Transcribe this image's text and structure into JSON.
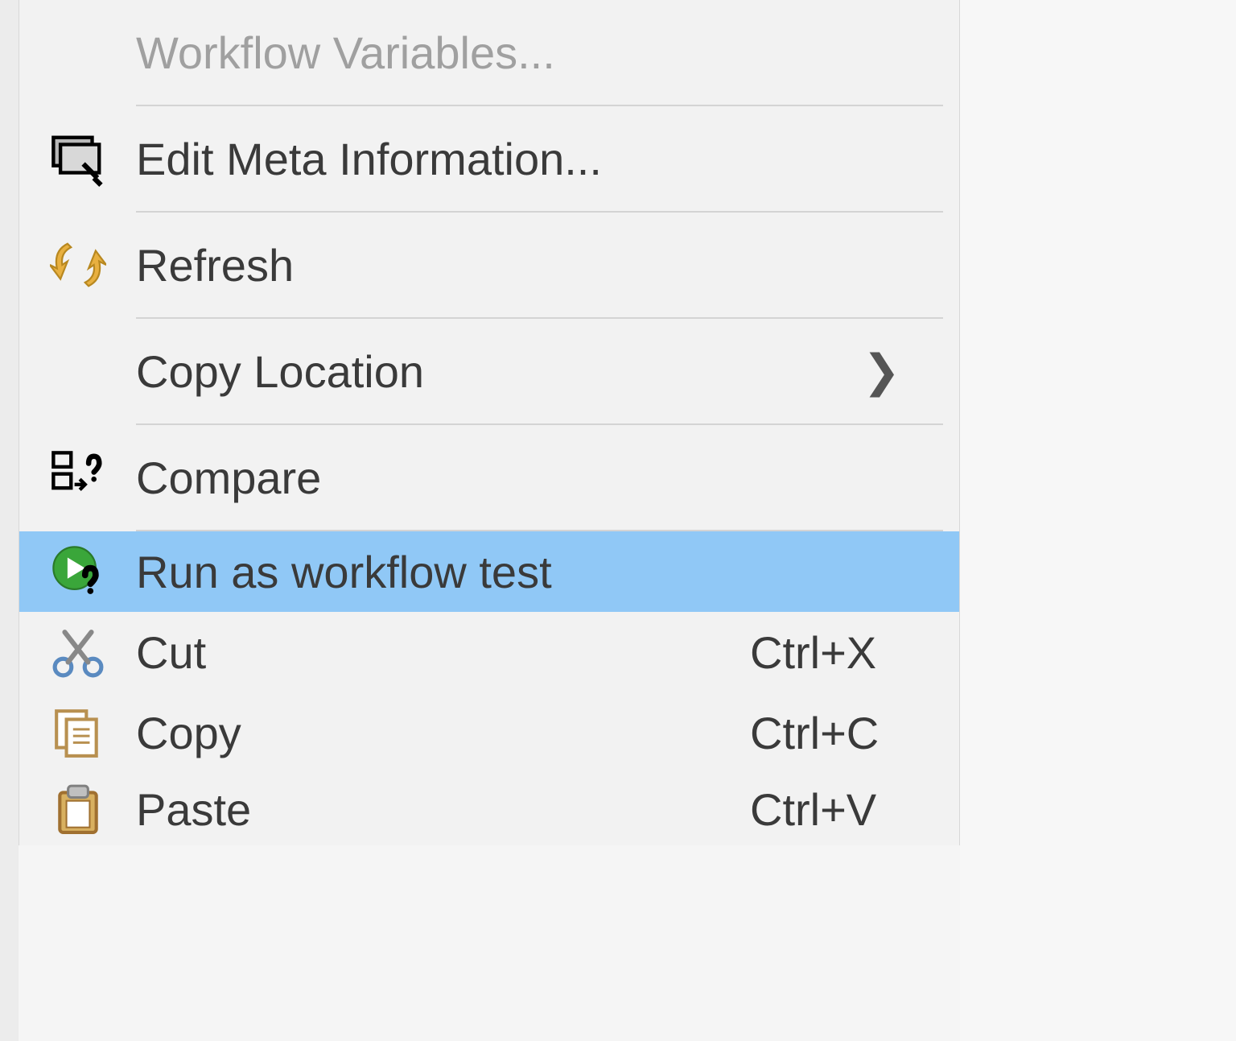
{
  "menu": {
    "workflow_variables": {
      "label": "Workflow Variables..."
    },
    "edit_meta": {
      "label": "Edit Meta Information..."
    },
    "refresh": {
      "label": "Refresh"
    },
    "copy_location": {
      "label": "Copy Location",
      "submenu_arrow": "❯"
    },
    "compare": {
      "label": "Compare"
    },
    "run_workflow_test": {
      "label": "Run as workflow test"
    },
    "cut": {
      "label": "Cut",
      "shortcut": "Ctrl+X"
    },
    "copy": {
      "label": "Copy",
      "shortcut": "Ctrl+C"
    },
    "paste": {
      "label": "Paste",
      "shortcut": "Ctrl+V"
    }
  }
}
